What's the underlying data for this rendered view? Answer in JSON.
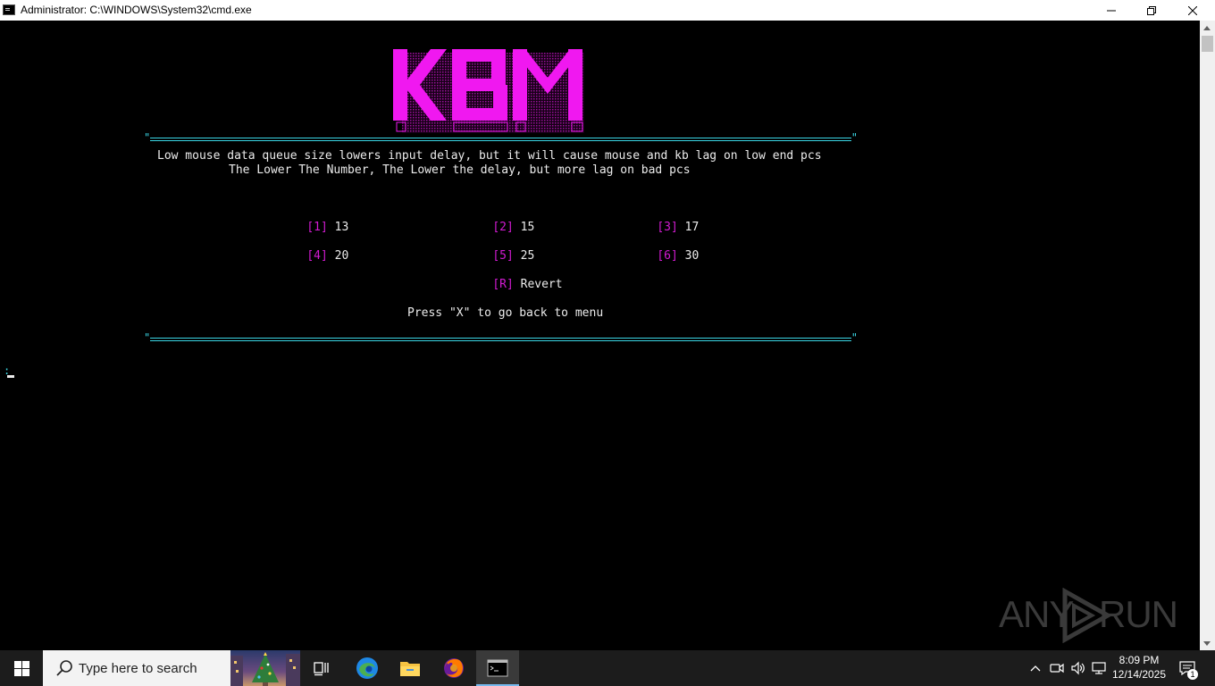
{
  "window": {
    "title": "Administrator: C:\\WINDOWS\\System32\\cmd.exe"
  },
  "console": {
    "logo_text": "KBM",
    "description_line1": "Low mouse data queue size lowers input delay, but it will cause mouse and kb lag on low end pcs",
    "description_line2": "The Lower The Number, The Lower the delay, but more lag on bad pcs",
    "options": [
      {
        "key": "[1]",
        "value": "13"
      },
      {
        "key": "[2]",
        "value": "15"
      },
      {
        "key": "[3]",
        "value": "17"
      },
      {
        "key": "[4]",
        "value": "20"
      },
      {
        "key": "[5]",
        "value": "25"
      },
      {
        "key": "[6]",
        "value": "30"
      },
      {
        "key": "[R]",
        "value": "Revert"
      }
    ],
    "back_hint": "Press \"X\" to go back to menu",
    "prompt": ":",
    "accent_color": "#d21bd2",
    "separator_color": "#3ad7e6"
  },
  "watermark": {
    "left_text": "ANY",
    "right_text": "RUN"
  },
  "taskbar": {
    "search_placeholder": "Type here to search",
    "time": "8:09 PM",
    "date": "12/14/2025",
    "notification_count": "1"
  }
}
